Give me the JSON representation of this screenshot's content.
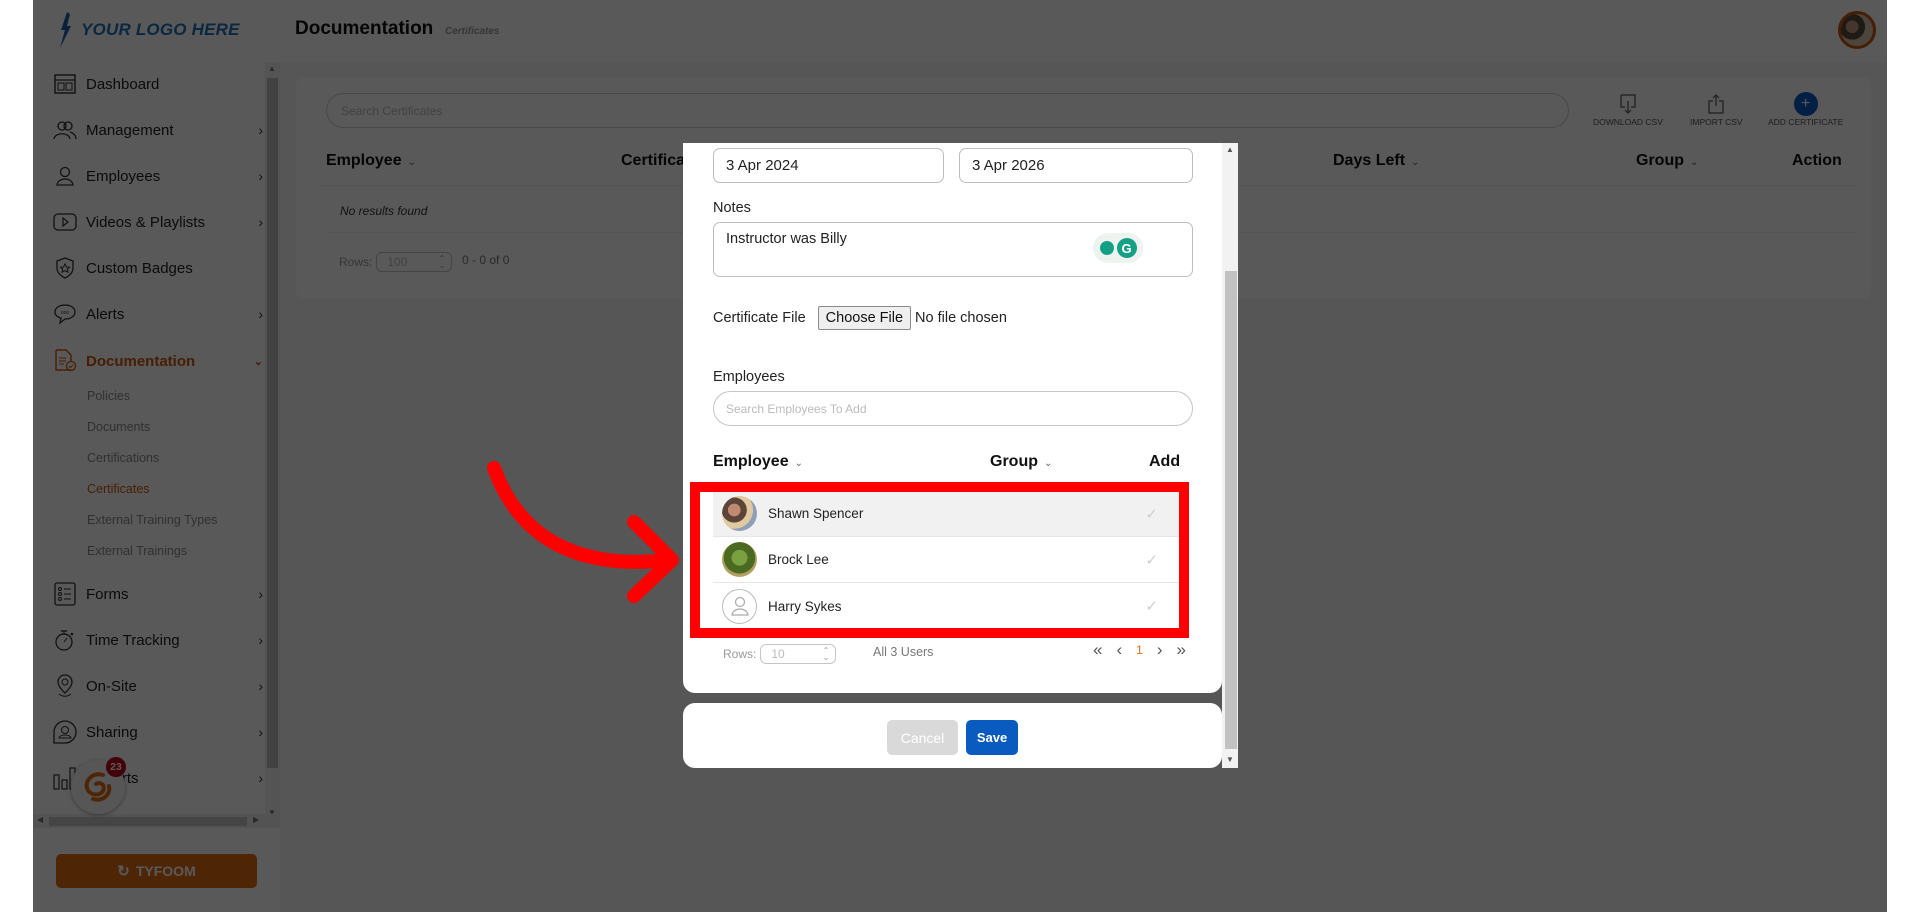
{
  "header": {
    "logo_text": "YOUR LOGO HERE",
    "title": "Documentation",
    "subtitle": "Certificates",
    "avatar_icon": "user-avatar"
  },
  "sidebar": {
    "items": [
      {
        "label": "Dashboard",
        "icon": "dashboard-icon",
        "has_children": false
      },
      {
        "label": "Management",
        "icon": "management-icon",
        "has_children": true
      },
      {
        "label": "Employees",
        "icon": "employee-icon",
        "has_children": true
      },
      {
        "label": "Videos & Playlists",
        "icon": "video-icon",
        "has_children": true
      },
      {
        "label": "Custom Badges",
        "icon": "badge-icon",
        "has_children": false
      },
      {
        "label": "Alerts",
        "icon": "alert-chat-icon",
        "has_children": true
      },
      {
        "label": "Documentation",
        "icon": "documentation-icon",
        "has_children": true,
        "expanded": true,
        "active": true
      },
      {
        "label": "Forms",
        "icon": "forms-icon",
        "has_children": true
      },
      {
        "label": "Time Tracking",
        "icon": "stopwatch-icon",
        "has_children": true
      },
      {
        "label": "On-Site",
        "icon": "location-pin-icon",
        "has_children": true
      },
      {
        "label": "Sharing",
        "icon": "sharing-icon",
        "has_children": true
      },
      {
        "label": "Reports",
        "icon": "reports-icon",
        "has_children": true
      }
    ],
    "documentation_subitems": [
      {
        "label": "Policies"
      },
      {
        "label": "Documents"
      },
      {
        "label": "Certifications"
      },
      {
        "label": "Certificates",
        "active": true
      },
      {
        "label": "External Training Types"
      },
      {
        "label": "External Trainings"
      }
    ],
    "tyfoom_button": "TYFOOM",
    "notification_count": "23"
  },
  "main": {
    "search_placeholder": "Search Certificates",
    "toolbar": {
      "download_csv": "DOWNLOAD CSV",
      "import_csv": "IMPORT CSV",
      "add_certificate": "ADD CERTIFICATE"
    },
    "columns": [
      "Employee",
      "Certifica",
      "Days Left",
      "Group",
      "Action"
    ],
    "empty_text": "No results found",
    "rows_label": "Rows:",
    "rows_value": "100",
    "range_text": "0 - 0 of 0"
  },
  "modal": {
    "issue_date": "3 Apr 2024",
    "expiry_date": "3 Apr 2026",
    "notes_label": "Notes",
    "notes_value": "Instructor was Billy",
    "file_label": "Certificate File",
    "file_button": "Choose File",
    "file_status": "No file chosen",
    "employees_label": "Employees",
    "employees_placeholder": "Search Employees To Add",
    "columns": {
      "employee": "Employee",
      "group": "Group",
      "add": "Add"
    },
    "employees": [
      {
        "name": "Shawn Spencer",
        "avatar": "photo",
        "group": "",
        "added": false
      },
      {
        "name": "Brock Lee",
        "avatar": "photo",
        "group": "",
        "added": false
      },
      {
        "name": "Harry Sykes",
        "avatar": "placeholder",
        "group": "",
        "added": false
      }
    ],
    "rows_label": "Rows:",
    "rows_value": "10",
    "total_text": "All 3 Users",
    "current_page": "1",
    "cancel_label": "Cancel",
    "save_label": "Save"
  },
  "colors": {
    "brand_orange": "#e36d0f",
    "primary_blue": "#0a5bbf",
    "annotation_red": "#ff0000"
  }
}
